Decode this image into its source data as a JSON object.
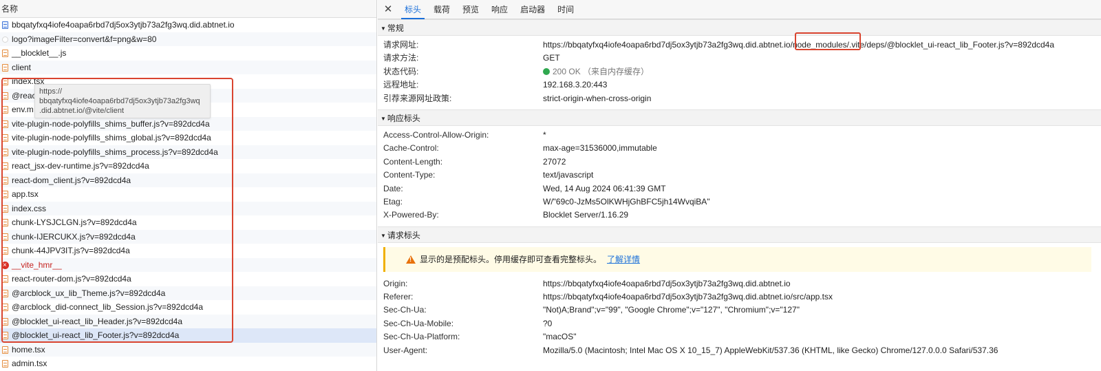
{
  "requests": {
    "header": "名称",
    "items": [
      {
        "name": "bbqatyfxq4iofe4oapa6rbd7dj5ox3ytjb73a2fg3wq.did.abtnet.io",
        "icon": "doc"
      },
      {
        "name": "logo?imageFilter=convert&f=png&w=80",
        "icon": "img"
      },
      {
        "name": "__blocklet__.js",
        "icon": "script"
      },
      {
        "name": "client",
        "icon": "script"
      },
      {
        "name": "index.tsx",
        "icon": "script"
      },
      {
        "name": "@react",
        "icon": "script"
      },
      {
        "name": "env.m",
        "icon": "script"
      },
      {
        "name": "vite-plugin-node-polyfills_shims_buffer.js?v=892dcd4a",
        "icon": "script"
      },
      {
        "name": "vite-plugin-node-polyfills_shims_global.js?v=892dcd4a",
        "icon": "script"
      },
      {
        "name": "vite-plugin-node-polyfills_shims_process.js?v=892dcd4a",
        "icon": "script"
      },
      {
        "name": "react_jsx-dev-runtime.js?v=892dcd4a",
        "icon": "script"
      },
      {
        "name": "react-dom_client.js?v=892dcd4a",
        "icon": "script"
      },
      {
        "name": "app.tsx",
        "icon": "script"
      },
      {
        "name": "index.css",
        "icon": "script"
      },
      {
        "name": "chunk-LYSJCLGN.js?v=892dcd4a",
        "icon": "script"
      },
      {
        "name": "chunk-IJERCUKX.js?v=892dcd4a",
        "icon": "script"
      },
      {
        "name": "chunk-44JPV3IT.js?v=892dcd4a",
        "icon": "script"
      },
      {
        "name": "__vite_hmr__",
        "icon": "error"
      },
      {
        "name": "react-router-dom.js?v=892dcd4a",
        "icon": "script"
      },
      {
        "name": "@arcblock_ux_lib_Theme.js?v=892dcd4a",
        "icon": "script"
      },
      {
        "name": "@arcblock_did-connect_lib_Session.js?v=892dcd4a",
        "icon": "script"
      },
      {
        "name": "@blocklet_ui-react_lib_Header.js?v=892dcd4a",
        "icon": "script"
      },
      {
        "name": "@blocklet_ui-react_lib_Footer.js?v=892dcd4a",
        "icon": "script",
        "selected": true
      },
      {
        "name": "home.tsx",
        "icon": "script"
      },
      {
        "name": "admin.tsx",
        "icon": "script"
      }
    ],
    "tooltip": [
      "https://",
      "bbqatyfxq4iofe4oapa6rbd7dj5ox3ytjb73a2fg3wq",
      ".did.abtnet.io/@vite/client"
    ]
  },
  "tabs": {
    "close": "✕",
    "items": [
      "标头",
      "载荷",
      "预览",
      "响应",
      "启动器",
      "时间"
    ],
    "active": 0
  },
  "general": {
    "title": "常规",
    "rows": [
      {
        "k": "请求网址:",
        "v": "https://bbqatyfxq4iofe4oapa6rbd7dj5ox3ytjb73a2fg3wq.did.abtnet.io/node_modules/.vite/deps/@blocklet_ui-react_lib_Footer.js?v=892dcd4a"
      },
      {
        "k": "请求方法:",
        "v": "GET"
      },
      {
        "k": "状态代码:",
        "v": "200 OK",
        "note": "（来自内存缓存）"
      },
      {
        "k": "远程地址:",
        "v": "192.168.3.20:443"
      },
      {
        "k": "引荐来源网址政策:",
        "v": "strict-origin-when-cross-origin"
      }
    ]
  },
  "response_headers": {
    "title": "响应标头",
    "rows": [
      {
        "k": "Access-Control-Allow-Origin:",
        "v": "*"
      },
      {
        "k": "Cache-Control:",
        "v": "max-age=31536000,immutable"
      },
      {
        "k": "Content-Length:",
        "v": "27072"
      },
      {
        "k": "Content-Type:",
        "v": "text/javascript"
      },
      {
        "k": "Date:",
        "v": "Wed, 14 Aug 2024 06:41:39 GMT"
      },
      {
        "k": "Etag:",
        "v": "W/\"69c0-JzMs5OlKWHjGhBFC5jh14WvqiBA\""
      },
      {
        "k": "X-Powered-By:",
        "v": "Blocklet Server/1.16.29"
      }
    ]
  },
  "request_headers": {
    "title": "请求标头",
    "warning": "显示的是预配标头。停用缓存即可查看完整标头。",
    "warning_link": "了解详情",
    "rows": [
      {
        "k": "Origin:",
        "v": "https://bbqatyfxq4iofe4oapa6rbd7dj5ox3ytjb73a2fg3wq.did.abtnet.io"
      },
      {
        "k": "Referer:",
        "v": "https://bbqatyfxq4iofe4oapa6rbd7dj5ox3ytjb73a2fg3wq.did.abtnet.io/src/app.tsx"
      },
      {
        "k": "Sec-Ch-Ua:",
        "v": "\"Not)A;Brand\";v=\"99\", \"Google Chrome\";v=\"127\", \"Chromium\";v=\"127\""
      },
      {
        "k": "Sec-Ch-Ua-Mobile:",
        "v": "?0"
      },
      {
        "k": "Sec-Ch-Ua-Platform:",
        "v": "\"macOS\""
      },
      {
        "k": "User-Agent:",
        "v": "Mozilla/5.0 (Macintosh; Intel Mac OS X 10_15_7) AppleWebKit/537.36 (KHTML, like Gecko) Chrome/127.0.0.0 Safari/537.36"
      }
    ]
  },
  "colors": {
    "accent": "#1a6fd9",
    "annotation": "#d9442f",
    "status_ok": "#2fa84f",
    "error": "#c5221f"
  }
}
